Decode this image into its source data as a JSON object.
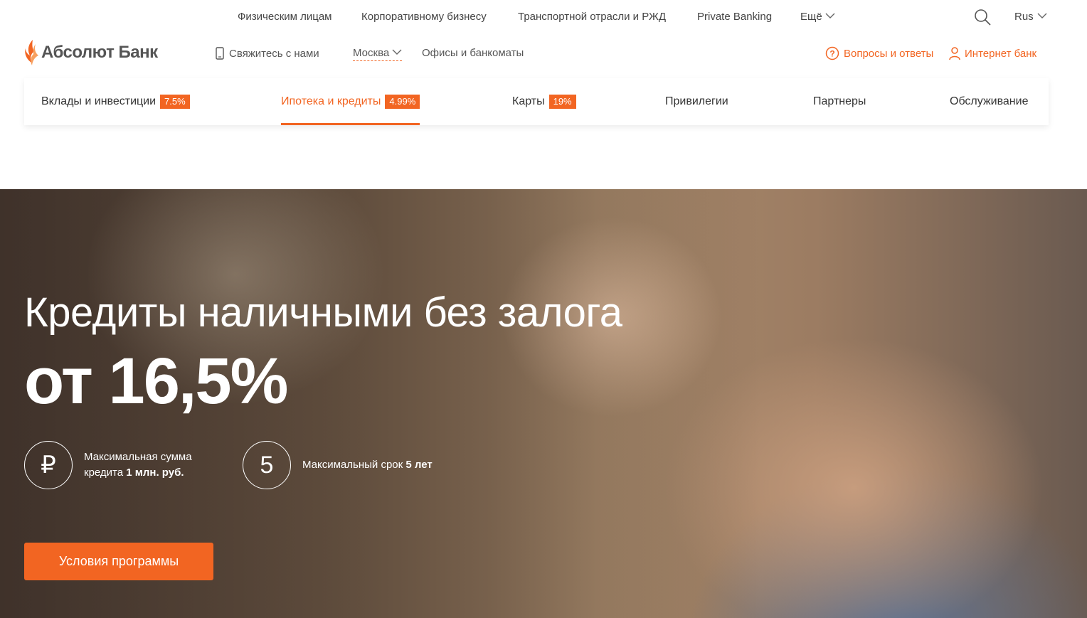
{
  "top_links": {
    "individuals": "Физическим лицам",
    "corporate": "Корпоративному бизнесу",
    "transport": "Транспортной отрасли и РЖД",
    "private": "Private Banking",
    "more": "Ещё"
  },
  "language": "Rus",
  "logo_text": "Абсолют Банк",
  "header": {
    "contact": "Свяжитесь с нами",
    "city": "Москва",
    "offices": "Офисы и банкоматы",
    "faq": "Вопросы и ответы",
    "internet_bank": "Интернет банк"
  },
  "categories": [
    {
      "label": "Вклады и инвестиции",
      "badge": "7.5%"
    },
    {
      "label": "Ипотека и кредиты",
      "badge": "4.99%"
    },
    {
      "label": "Карты",
      "badge": "19%"
    },
    {
      "label": "Привилегии"
    },
    {
      "label": "Партнеры"
    },
    {
      "label": "Обслуживание"
    }
  ],
  "hero": {
    "title": "Кредиты наличными без залога",
    "rate": "от 16,5%",
    "feature1": {
      "icon": "₽",
      "line1": "Максимальная сумма",
      "line2_prefix": "кредита ",
      "line2_bold": "1 млн. руб."
    },
    "feature2": {
      "icon": "5",
      "prefix": "Максимальный срок ",
      "bold": "5 лет"
    },
    "cta": "Условия программы"
  },
  "colors": {
    "accent": "#f26522"
  }
}
